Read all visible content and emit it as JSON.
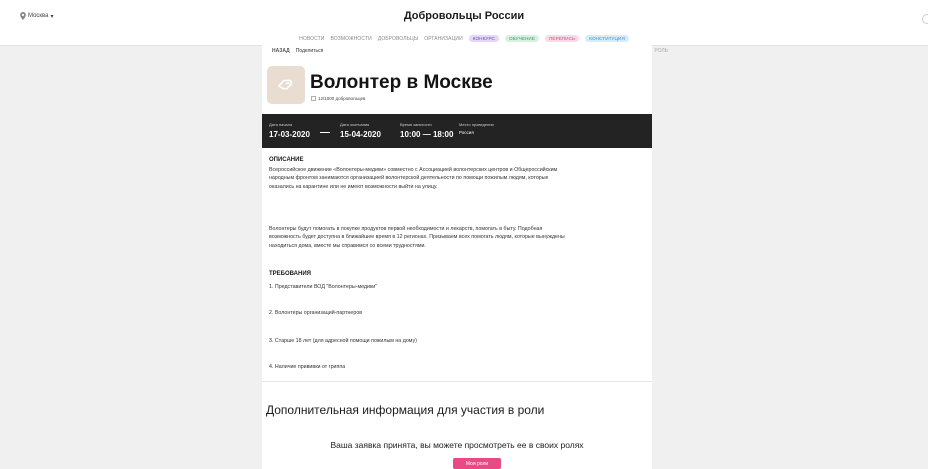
{
  "header": {
    "city": "Москва",
    "site_title": "Добровольцы России",
    "nav": [
      "НОВОСТИ",
      "ВОЗМОЖНОСТИ",
      "ДОБРОВОЛЬЦЫ",
      "ОРГАНИЗАЦИИ"
    ],
    "pills": [
      "КОНКУРС",
      "ОБУЧЕНИЕ",
      "ПЕРЕПИСЬ",
      "КОНСТИТУЦИЯ"
    ],
    "pill_colors": [
      "#e3d8f5",
      "#d7f0e0",
      "#fbd9e6",
      "#d6ecfa"
    ]
  },
  "toolbar": {
    "back": "НАЗАД",
    "share": "Поделиться",
    "role": "РОЛЬ"
  },
  "event": {
    "title": "Волонтер в Москве",
    "participants": "12/1000 добровольцев"
  },
  "details": {
    "start_label": "Дата начала",
    "start_value": "17-03-2020",
    "end_label": "Дата окончания",
    "end_value": "15-04-2020",
    "time_label": "Время занятости",
    "time_from": "10:00",
    "time_to": "18:00",
    "place_label": "Место проведения",
    "place_value": "Россия"
  },
  "description": {
    "heading": "ОПИСАНИЕ",
    "paragraph1": "Всероссийское движение «Волонтеры-медики» совместно с Ассоциацией волонтерских центров и Общероссийским народным фронтом занимаются организацией волонтерской деятельности по помощи пожилым людям, которые оказались на карантине или не имеют возможности выйти на улицу.",
    "paragraph2": "Волонтеры будут помогать в покупке продуктов первой необходимости и лекарств, помогать в быту. Подобная возможность будет доступна в ближайшее время в 12 регионах. Призываем всех помогать людям, которые вынуждены находиться дома, вместе мы справимся со всеми трудностями."
  },
  "requirements": {
    "heading": "ТРЕБОВАНИЯ",
    "items": [
      "1. Представители ВОД \"Волонтеры-медики\"",
      "2. Волонтеры организаций-партнеров",
      "3. Старше 18 лет (для адресной помощи пожилым на дому)",
      "4. Наличие прививки от гриппа"
    ]
  },
  "extra": {
    "title": "Дополнительная информация для участия в роли",
    "accepted_text": "Ваша заявка принята, вы можете просмотреть ее в своих ролях",
    "my_roles_button": "Мои роли"
  },
  "colors": {
    "accent": "#e84a86",
    "dark_band": "#232323",
    "logo_bg": "#e8ddd0"
  }
}
